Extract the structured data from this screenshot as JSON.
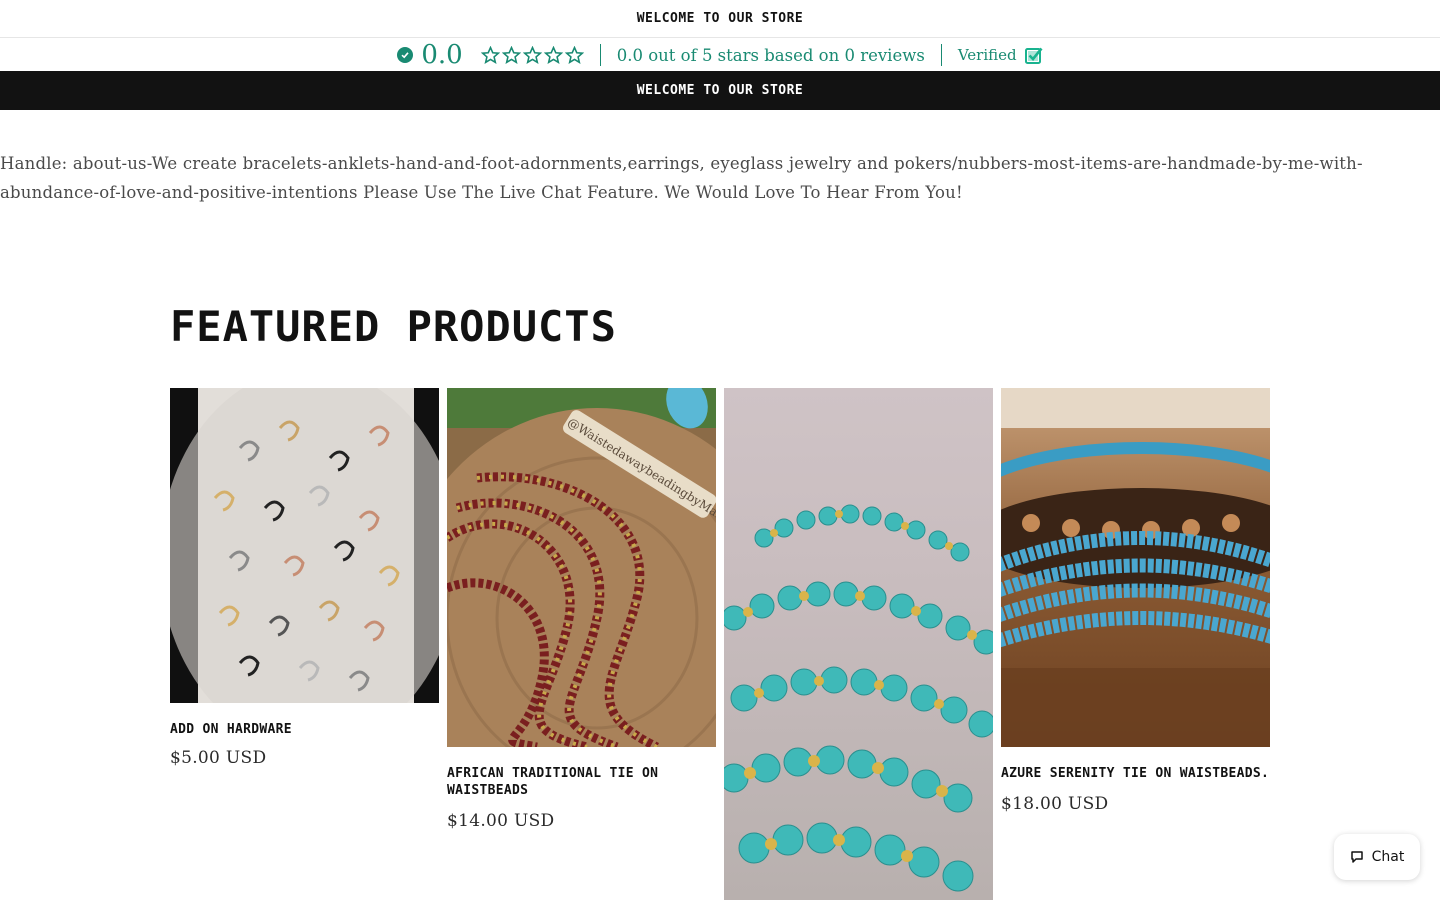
{
  "announcement_top": "WELCOME TO OUR STORE",
  "reviews": {
    "score": "0.0",
    "rating_of_5": 0,
    "summary": "0.0 out of 5 stars based on 0 reviews",
    "verified_label": "Verified",
    "icons": [
      "check-circle-icon",
      "star-outline-icon",
      "verified-badge-icon"
    ]
  },
  "announcement_dark": "WELCOME TO OUR STORE",
  "page_text": "Handle: about-us-We create bracelets-anklets-hand-and-foot-adornments,earrings, eyeglass jewelry and pokers/nubbers-most-items-are-handmade-by-me-with-abundance-of-love-and-positive-intentions Please Use The Live Chat Feature. We Would Love To Hear From You!",
  "featured": {
    "title": "Featured products",
    "products": [
      {
        "name": "Add On Hardware",
        "price": "$5.00 USD"
      },
      {
        "name": "African Traditional Tie On Waistbeads",
        "price": "$14.00 USD"
      },
      {
        "name": "",
        "price": ""
      },
      {
        "name": "Azure Serenity Tie On Waistbeads.",
        "price": "$18.00 USD"
      }
    ]
  },
  "product_images": {
    "1_watermark": "@WaistedawaybeadingbyMaryK"
  },
  "chat": {
    "label": "Chat"
  },
  "colors": {
    "accent_green": "#198a72",
    "dark_bar": "#121212",
    "body_text": "#4a4a4a"
  }
}
